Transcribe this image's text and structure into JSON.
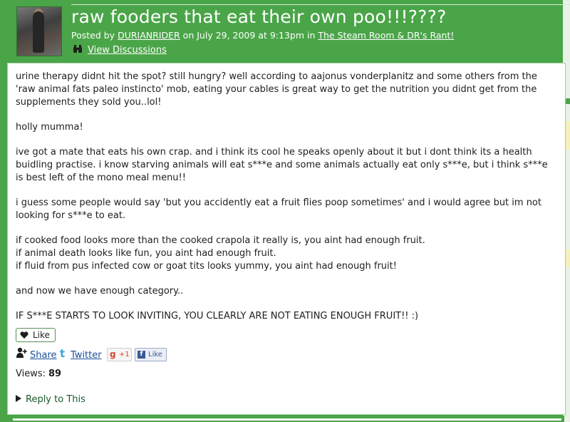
{
  "post": {
    "title": "raw fooders that eat their own poo!!!????",
    "meta_prefix": "Posted by ",
    "author": "DURIANRIDER",
    "meta_date": " on July 29, 2009 at 9:13pm in ",
    "forum": "The Steam Room & DR's Rant!",
    "view_discussions": "View Discussions",
    "paragraphs": [
      "urine therapy didnt hit the spot? still hungry? well according to aajonus vonderplanitz and some others from the 'raw animal fats paleo instincto' mob, eating your cables is great way to get the nutrition you didnt get from the supplements they sold you..lol!",
      "holly mumma!",
      "ive got a mate that eats his own crap. and i think its cool he speaks openly about it but i dont think its a health buidling practise. i know starving animals will eat s***e and some animals actually eat only s***e, but i think s***e is best left of the mono meal menu!!",
      "i guess some people would say 'but you accidently eat a fruit flies poop sometimes' and i would agree but im not looking for s***e to eat.",
      "if cooked food looks more than the cooked crapola it really is, you aint had enough fruit.",
      "if animal death looks like fun, you aint had enough fruit.",
      "if fluid from pus infected cow or goat tits looks yummy, you aint had enough fruit!",
      "and now we have enough category..",
      "IF S***E STARTS TO LOOK INVITING, YOU CLEARLY ARE NOT EATING ENOUGH FRUIT!! :)"
    ]
  },
  "actions": {
    "like": "Like",
    "share": "Share",
    "twitter": "Twitter",
    "gplus": "+1",
    "fb_like": "Like",
    "views_label": "Views:",
    "views_count": "89",
    "reply": "Reply to This"
  },
  "colors": {
    "brand_green": "#4aa548",
    "link_blue": "#1a4f9b"
  }
}
